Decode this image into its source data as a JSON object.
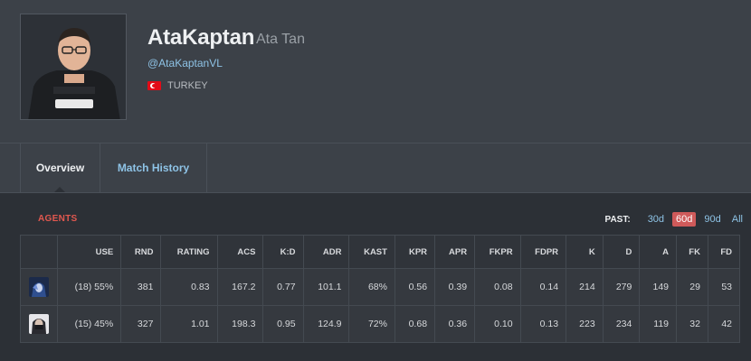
{
  "player": {
    "name": "AtaKaptan",
    "real_name": "Ata Tan",
    "handle": "@AtaKaptanVL",
    "country": "TURKEY"
  },
  "tabs": [
    "Overview",
    "Match History"
  ],
  "agents_section": {
    "title": "AGENTS",
    "past_label": "PAST:",
    "periods": [
      "30d",
      "60d",
      "90d",
      "All"
    ],
    "active_period": "60d",
    "columns": [
      "USE",
      "RND",
      "RATING",
      "ACS",
      "K:D",
      "ADR",
      "KAST",
      "KPR",
      "APR",
      "FKPR",
      "FDPR",
      "K",
      "D",
      "A",
      "FK",
      "FD"
    ],
    "rows": [
      {
        "agent_icon": "agent-icon-blue-hooded",
        "values": [
          "(18) 55%",
          "381",
          "0.83",
          "167.2",
          "0.77",
          "101.1",
          "68%",
          "0.56",
          "0.39",
          "0.08",
          "0.14",
          "214",
          "279",
          "149",
          "29",
          "53"
        ]
      },
      {
        "agent_icon": "agent-icon-white-masked",
        "values": [
          "(15) 45%",
          "327",
          "1.01",
          "198.3",
          "0.95",
          "124.9",
          "72%",
          "0.68",
          "0.36",
          "0.10",
          "0.13",
          "223",
          "234",
          "119",
          "32",
          "42"
        ]
      }
    ]
  },
  "colors": {
    "accent_red": "#e2584f",
    "link_blue": "#8ec3e6",
    "active_period_bg": "#cf5a5a"
  }
}
